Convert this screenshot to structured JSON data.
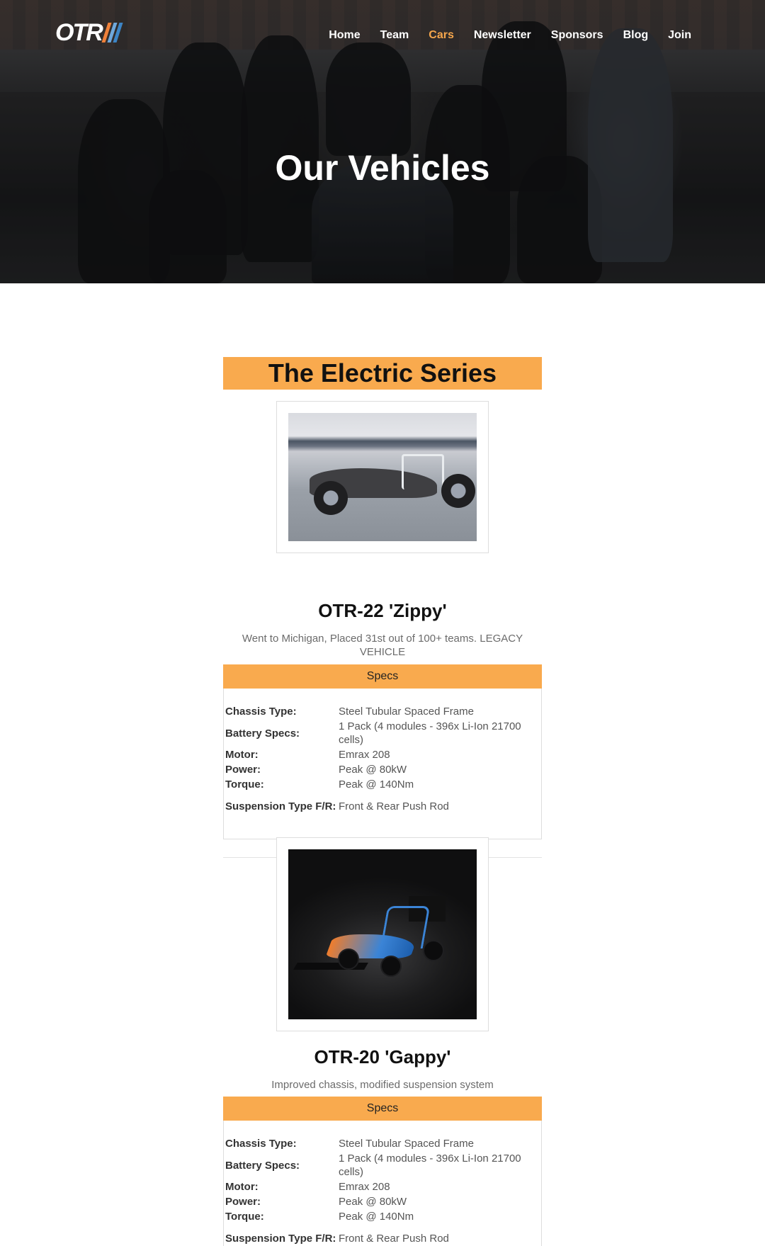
{
  "brand": {
    "logo_text": "OTR",
    "stripe_colors": [
      "#f0813a",
      "#6fa8dc",
      "#3d85c6"
    ]
  },
  "nav": {
    "items": [
      {
        "label": "Home",
        "active": false
      },
      {
        "label": "Team",
        "active": false
      },
      {
        "label": "Cars",
        "active": true
      },
      {
        "label": "Newsletter",
        "active": false
      },
      {
        "label": "Sponsors",
        "active": false
      },
      {
        "label": "Blog",
        "active": false
      },
      {
        "label": "Join",
        "active": false
      }
    ],
    "active_color": "#f5a64c"
  },
  "hero": {
    "title": "Our Vehicles"
  },
  "series": {
    "title": "The Electric Series",
    "accent_color": "#f9aa4e"
  },
  "vehicles": [
    {
      "name": "OTR-22 'Zippy'",
      "description": "Went to Michigan, Placed 31st out of 100+ teams. LEGACY VEHICLE",
      "specs_label": "Specs",
      "specs": [
        {
          "label": "Chassis Type:",
          "value": "Steel Tubular Spaced Frame"
        },
        {
          "label": "Battery Specs:",
          "value": "1 Pack (4 modules - 396x Li-Ion 21700 cells)"
        },
        {
          "label": "Motor:",
          "value": "Emrax 208"
        },
        {
          "label": "Power:",
          "value": "Peak @ 80kW"
        },
        {
          "label": "Torque:",
          "value": "Peak @ 140Nm"
        },
        {
          "label": "Suspension Type F/R:",
          "value": "Front & Rear Push Rod"
        }
      ]
    },
    {
      "name": "OTR-20 'Gappy'",
      "description": "Improved chassis, modified suspension system",
      "specs_label": "Specs",
      "specs": [
        {
          "label": "Chassis Type:",
          "value": "Steel Tubular Spaced Frame"
        },
        {
          "label": "Battery Specs:",
          "value": "1 Pack (4 modules - 396x Li-Ion 21700 cells)"
        },
        {
          "label": "Motor:",
          "value": "Emrax 208"
        },
        {
          "label": "Power:",
          "value": "Peak @ 80kW"
        },
        {
          "label": "Torque:",
          "value": "Peak @ 140Nm"
        },
        {
          "label": "Suspension Type F/R:",
          "value": "Front & Rear Push Rod"
        }
      ]
    }
  ]
}
